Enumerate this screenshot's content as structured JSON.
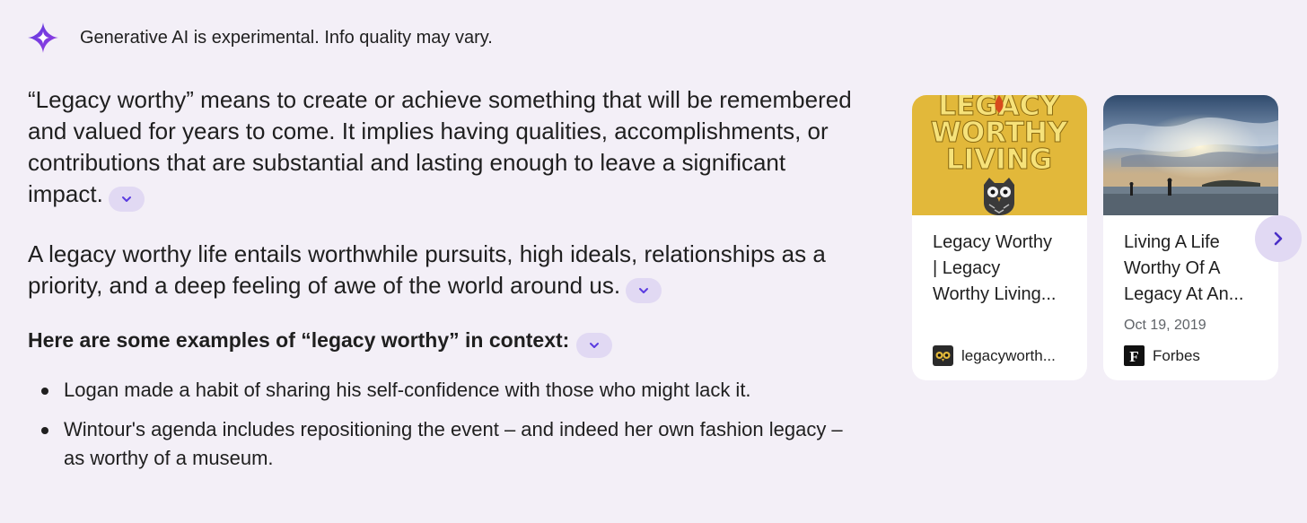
{
  "header": {
    "disclaimer": "Generative AI is experimental. Info quality may vary.",
    "icon": "sparkle-icon"
  },
  "answer": {
    "paragraphs": [
      "“Legacy worthy” means to create or achieve something that will be remembered and valued for years to come. It implies having qualities, accomplishments, or contributions that are substantial and lasting enough to leave a significant impact.",
      "A legacy worthy life entails worthwhile pursuits, high ideals, relationships as a priority, and a deep feeling of awe of the world around us."
    ],
    "examples_heading": "Here are some examples of “legacy worthy” in context:",
    "examples": [
      "Logan made a habit of sharing his self-confidence with those who might lack it.",
      "Wintour's agenda includes repositioning the event – and indeed her own fashion legacy – as worthy of a museum."
    ]
  },
  "cards": [
    {
      "title_lines": [
        "Legacy Worthy",
        "| Legacy",
        "Worthy Living..."
      ],
      "date": "",
      "source": "legacyworth...",
      "image_text": [
        "LEGACY",
        "WORTHY",
        "LIVING"
      ],
      "favicon": "owl-icon"
    },
    {
      "title_lines": [
        "Living A Life",
        "Worthy Of A",
        "Legacy At An..."
      ],
      "date": "Oct 19, 2019",
      "source": "Forbes",
      "favicon_letter": "F"
    }
  ],
  "colors": {
    "background": "#f3eff7",
    "accent": "#7c4dff",
    "chip": "#e1d9f3",
    "card": "#ffffff",
    "image_yellow": "#e2b83a"
  }
}
